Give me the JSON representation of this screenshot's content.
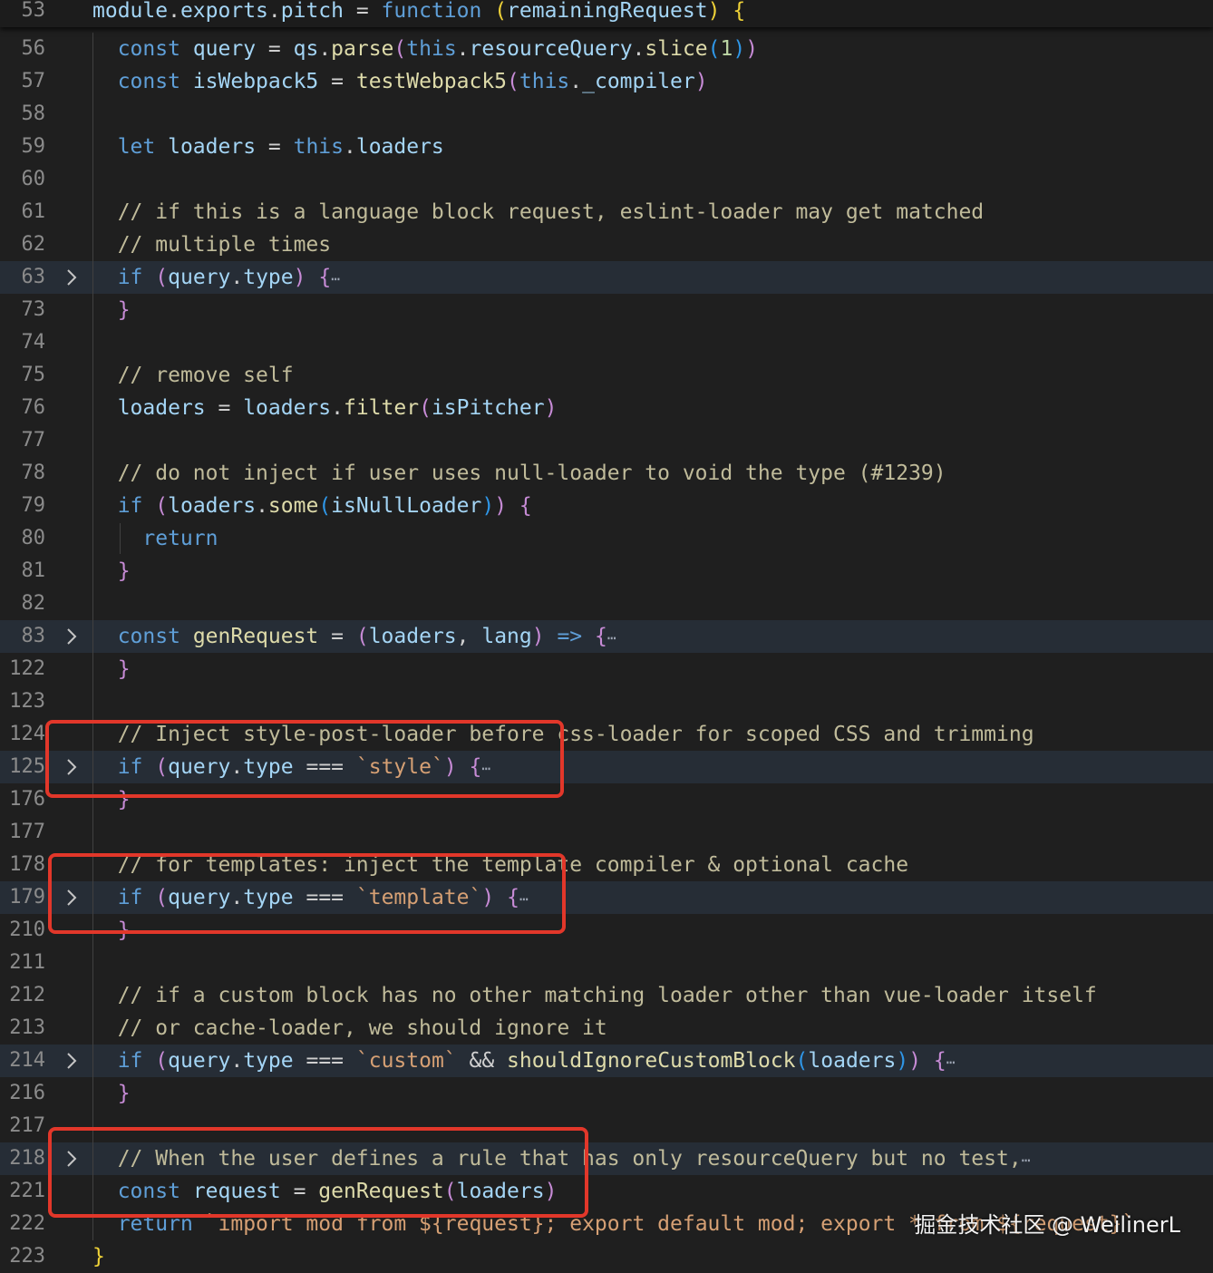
{
  "editor": {
    "lines": [
      {
        "n": "53",
        "fold": false,
        "folded": false,
        "sticky": true,
        "tokens": [
          [
            "var",
            "module"
          ],
          [
            "",
            "."
          ],
          [
            "var",
            "exports"
          ],
          [
            "",
            "."
          ],
          [
            "var",
            "pitch"
          ],
          [
            "",
            " = "
          ],
          [
            "kw",
            "function"
          ],
          [
            "",
            " "
          ],
          [
            "p1",
            "("
          ],
          [
            "var",
            "remainingRequest"
          ],
          [
            "p1",
            ")"
          ],
          [
            "",
            " "
          ],
          [
            "p1",
            "{"
          ]
        ]
      },
      {
        "n": "56",
        "fold": false,
        "folded": false,
        "tokens": [
          [
            "",
            "  "
          ],
          [
            "kw",
            "const"
          ],
          [
            "",
            " "
          ],
          [
            "var",
            "query"
          ],
          [
            "",
            " = "
          ],
          [
            "var",
            "qs"
          ],
          [
            "",
            "."
          ],
          [
            "fn",
            "parse"
          ],
          [
            "p2",
            "("
          ],
          [
            "kw",
            "this"
          ],
          [
            "",
            "."
          ],
          [
            "var",
            "resourceQuery"
          ],
          [
            "",
            "."
          ],
          [
            "fn",
            "slice"
          ],
          [
            "p3",
            "("
          ],
          [
            "num",
            "1"
          ],
          [
            "p3",
            ")"
          ],
          [
            "p2",
            ")"
          ]
        ]
      },
      {
        "n": "57",
        "fold": false,
        "folded": false,
        "tokens": [
          [
            "",
            "  "
          ],
          [
            "kw",
            "const"
          ],
          [
            "",
            " "
          ],
          [
            "var",
            "isWebpack5"
          ],
          [
            "",
            " = "
          ],
          [
            "fn",
            "testWebpack5"
          ],
          [
            "p2",
            "("
          ],
          [
            "kw",
            "this"
          ],
          [
            "",
            "."
          ],
          [
            "var",
            "_compiler"
          ],
          [
            "p2",
            ")"
          ]
        ]
      },
      {
        "n": "58",
        "fold": false,
        "folded": false,
        "tokens": []
      },
      {
        "n": "59",
        "fold": false,
        "folded": false,
        "tokens": [
          [
            "",
            "  "
          ],
          [
            "kw",
            "let"
          ],
          [
            "",
            " "
          ],
          [
            "var",
            "loaders"
          ],
          [
            "",
            " = "
          ],
          [
            "kw",
            "this"
          ],
          [
            "",
            "."
          ],
          [
            "var",
            "loaders"
          ]
        ]
      },
      {
        "n": "60",
        "fold": false,
        "folded": false,
        "tokens": []
      },
      {
        "n": "61",
        "fold": false,
        "folded": false,
        "tokens": [
          [
            "",
            "  "
          ],
          [
            "cmt",
            "// if this is a language block request, eslint-loader may get matched"
          ]
        ]
      },
      {
        "n": "62",
        "fold": false,
        "folded": false,
        "tokens": [
          [
            "",
            "  "
          ],
          [
            "cmt",
            "// multiple times"
          ]
        ]
      },
      {
        "n": "63",
        "fold": true,
        "folded": true,
        "tokens": [
          [
            "",
            "  "
          ],
          [
            "kw",
            "if"
          ],
          [
            "",
            " "
          ],
          [
            "p2",
            "("
          ],
          [
            "var",
            "query"
          ],
          [
            "",
            "."
          ],
          [
            "var",
            "type"
          ],
          [
            "p2",
            ")"
          ],
          [
            "",
            " "
          ],
          [
            "p2",
            "{"
          ],
          [
            "ellipsis",
            "⋯"
          ]
        ]
      },
      {
        "n": "73",
        "fold": false,
        "folded": false,
        "tokens": [
          [
            "",
            "  "
          ],
          [
            "p2",
            "}"
          ]
        ]
      },
      {
        "n": "74",
        "fold": false,
        "folded": false,
        "tokens": []
      },
      {
        "n": "75",
        "fold": false,
        "folded": false,
        "tokens": [
          [
            "",
            "  "
          ],
          [
            "cmt",
            "// remove self"
          ]
        ]
      },
      {
        "n": "76",
        "fold": false,
        "folded": false,
        "tokens": [
          [
            "",
            "  "
          ],
          [
            "var",
            "loaders"
          ],
          [
            "",
            " = "
          ],
          [
            "var",
            "loaders"
          ],
          [
            "",
            "."
          ],
          [
            "fn",
            "filter"
          ],
          [
            "p2",
            "("
          ],
          [
            "var",
            "isPitcher"
          ],
          [
            "p2",
            ")"
          ]
        ]
      },
      {
        "n": "77",
        "fold": false,
        "folded": false,
        "tokens": []
      },
      {
        "n": "78",
        "fold": false,
        "folded": false,
        "tokens": [
          [
            "",
            "  "
          ],
          [
            "cmt",
            "// do not inject if user uses null-loader to void the type (#1239)"
          ]
        ]
      },
      {
        "n": "79",
        "fold": false,
        "folded": false,
        "tokens": [
          [
            "",
            "  "
          ],
          [
            "kw",
            "if"
          ],
          [
            "",
            " "
          ],
          [
            "p2",
            "("
          ],
          [
            "var",
            "loaders"
          ],
          [
            "",
            "."
          ],
          [
            "fn",
            "some"
          ],
          [
            "p3",
            "("
          ],
          [
            "var",
            "isNullLoader"
          ],
          [
            "p3",
            ")"
          ],
          [
            "p2",
            ")"
          ],
          [
            "",
            " "
          ],
          [
            "p2",
            "{"
          ]
        ]
      },
      {
        "n": "80",
        "fold": false,
        "folded": false,
        "tokens": [
          [
            "",
            "    "
          ],
          [
            "kw",
            "return"
          ]
        ]
      },
      {
        "n": "81",
        "fold": false,
        "folded": false,
        "tokens": [
          [
            "",
            "  "
          ],
          [
            "p2",
            "}"
          ]
        ]
      },
      {
        "n": "82",
        "fold": false,
        "folded": false,
        "tokens": []
      },
      {
        "n": "83",
        "fold": true,
        "folded": true,
        "tokens": [
          [
            "",
            "  "
          ],
          [
            "kw",
            "const"
          ],
          [
            "",
            " "
          ],
          [
            "fn",
            "genRequest"
          ],
          [
            "",
            " = "
          ],
          [
            "p2",
            "("
          ],
          [
            "var",
            "loaders"
          ],
          [
            "",
            ", "
          ],
          [
            "var",
            "lang"
          ],
          [
            "p2",
            ")"
          ],
          [
            "",
            " "
          ],
          [
            "kw",
            "=>"
          ],
          [
            "",
            " "
          ],
          [
            "p2",
            "{"
          ],
          [
            "ellipsis",
            "⋯"
          ]
        ]
      },
      {
        "n": "122",
        "fold": false,
        "folded": false,
        "tokens": [
          [
            "",
            "  "
          ],
          [
            "p2",
            "}"
          ]
        ]
      },
      {
        "n": "123",
        "fold": false,
        "folded": false,
        "tokens": []
      },
      {
        "n": "124",
        "fold": false,
        "folded": false,
        "tokens": [
          [
            "",
            "  "
          ],
          [
            "cmt",
            "// Inject style-post-loader before css-loader for scoped CSS and trimming"
          ]
        ]
      },
      {
        "n": "125",
        "fold": true,
        "folded": true,
        "tokens": [
          [
            "",
            "  "
          ],
          [
            "kw",
            "if"
          ],
          [
            "",
            " "
          ],
          [
            "p2",
            "("
          ],
          [
            "var",
            "query"
          ],
          [
            "",
            "."
          ],
          [
            "var",
            "type"
          ],
          [
            "",
            " === "
          ],
          [
            "str",
            "`style`"
          ],
          [
            "p2",
            ")"
          ],
          [
            "",
            " "
          ],
          [
            "p2",
            "{"
          ],
          [
            "ellipsis",
            "⋯"
          ]
        ]
      },
      {
        "n": "176",
        "fold": false,
        "folded": false,
        "tokens": [
          [
            "",
            "  "
          ],
          [
            "p2",
            "}"
          ]
        ]
      },
      {
        "n": "177",
        "fold": false,
        "folded": false,
        "tokens": []
      },
      {
        "n": "178",
        "fold": false,
        "folded": false,
        "tokens": [
          [
            "",
            "  "
          ],
          [
            "cmt",
            "// for templates: inject the template compiler & optional cache"
          ]
        ]
      },
      {
        "n": "179",
        "fold": true,
        "folded": true,
        "tokens": [
          [
            "",
            "  "
          ],
          [
            "kw",
            "if"
          ],
          [
            "",
            " "
          ],
          [
            "p2",
            "("
          ],
          [
            "var",
            "query"
          ],
          [
            "",
            "."
          ],
          [
            "var",
            "type"
          ],
          [
            "",
            " === "
          ],
          [
            "str",
            "`template`"
          ],
          [
            "p2",
            ")"
          ],
          [
            "",
            " "
          ],
          [
            "p2",
            "{"
          ],
          [
            "ellipsis",
            "⋯"
          ]
        ]
      },
      {
        "n": "210",
        "fold": false,
        "folded": false,
        "tokens": [
          [
            "",
            "  "
          ],
          [
            "p2",
            "}"
          ]
        ]
      },
      {
        "n": "211",
        "fold": false,
        "folded": false,
        "tokens": []
      },
      {
        "n": "212",
        "fold": false,
        "folded": false,
        "tokens": [
          [
            "",
            "  "
          ],
          [
            "cmt",
            "// if a custom block has no other matching loader other than vue-loader itself"
          ]
        ]
      },
      {
        "n": "213",
        "fold": false,
        "folded": false,
        "tokens": [
          [
            "",
            "  "
          ],
          [
            "cmt",
            "// or cache-loader, we should ignore it"
          ]
        ]
      },
      {
        "n": "214",
        "fold": true,
        "folded": true,
        "tokens": [
          [
            "",
            "  "
          ],
          [
            "kw",
            "if"
          ],
          [
            "",
            " "
          ],
          [
            "p2",
            "("
          ],
          [
            "var",
            "query"
          ],
          [
            "",
            "."
          ],
          [
            "var",
            "type"
          ],
          [
            "",
            " === "
          ],
          [
            "str",
            "`custom`"
          ],
          [
            "",
            " && "
          ],
          [
            "fn",
            "shouldIgnoreCustomBlock"
          ],
          [
            "p3",
            "("
          ],
          [
            "var",
            "loaders"
          ],
          [
            "p3",
            ")"
          ],
          [
            "p2",
            ")"
          ],
          [
            "",
            " "
          ],
          [
            "p2",
            "{"
          ],
          [
            "ellipsis",
            "⋯"
          ]
        ]
      },
      {
        "n": "216",
        "fold": false,
        "folded": false,
        "tokens": [
          [
            "",
            "  "
          ],
          [
            "p2",
            "}"
          ]
        ]
      },
      {
        "n": "217",
        "fold": false,
        "folded": false,
        "tokens": []
      },
      {
        "n": "218",
        "fold": true,
        "folded": true,
        "tokens": [
          [
            "",
            "  "
          ],
          [
            "cmt",
            "// When the user defines a rule that has only resourceQuery but no test,"
          ],
          [
            "ellipsis",
            "⋯"
          ]
        ]
      },
      {
        "n": "221",
        "fold": false,
        "folded": false,
        "tokens": [
          [
            "",
            "  "
          ],
          [
            "kw",
            "const"
          ],
          [
            "",
            " "
          ],
          [
            "var",
            "request"
          ],
          [
            "",
            " = "
          ],
          [
            "fn",
            "genRequest"
          ],
          [
            "p2",
            "("
          ],
          [
            "var",
            "loaders"
          ],
          [
            "p2",
            ")"
          ]
        ]
      },
      {
        "n": "222",
        "fold": false,
        "folded": false,
        "tokens": [
          [
            "",
            "  "
          ],
          [
            "kw",
            "return"
          ],
          [
            "",
            " "
          ],
          [
            "str",
            "`import mod from ${request}; export default mod; export * from ${request}`"
          ]
        ]
      },
      {
        "n": "223",
        "fold": false,
        "folded": false,
        "tokens": [
          [
            "p1",
            "}"
          ]
        ]
      }
    ]
  },
  "watermark": "掘金技术社区 @ WeilinerL",
  "colors": {
    "background": "#1f1f1f",
    "highlight_box": "#e2372a",
    "folded_line": "#262d36"
  }
}
